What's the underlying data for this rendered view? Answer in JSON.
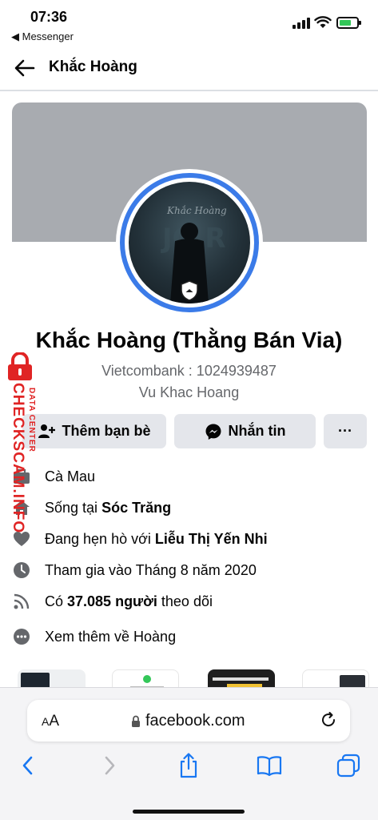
{
  "status_bar": {
    "time": "07:36",
    "back_app": "◀ Messenger"
  },
  "header": {
    "title": "Khắc Hoàng"
  },
  "profile": {
    "name": "Khắc Hoàng (Thằng Bán Via)",
    "bank_line": "Vietcombank : 1024939487",
    "alt_name": "Vu Khac Hoang"
  },
  "actions": {
    "add_friend": "Thêm bạn bè",
    "message": "Nhắn tin",
    "more": "···"
  },
  "details": {
    "work": "Cà Mau",
    "lives_prefix": "Sống tại ",
    "lives_place": "Sóc Trăng",
    "dating_prefix": "Đang hẹn hò với ",
    "dating_name": "Liễu Thị Yến Nhi",
    "joined": "Tham gia vào Tháng 8 năm 2020",
    "followers_prefix": "Có ",
    "followers_count": "37.085 người",
    "followers_suffix": " theo dõi",
    "see_more": "Xem thêm về Hoàng"
  },
  "watermark": {
    "text": "CHECKSCAM.INFO",
    "sub": "DATA CENTER"
  },
  "browser": {
    "aa_large": "A",
    "aa_small": "A",
    "url": "facebook.com"
  },
  "colors": {
    "accent": "#3b7be8",
    "safari_blue": "#1877f2",
    "watermark_red": "#e02424"
  }
}
